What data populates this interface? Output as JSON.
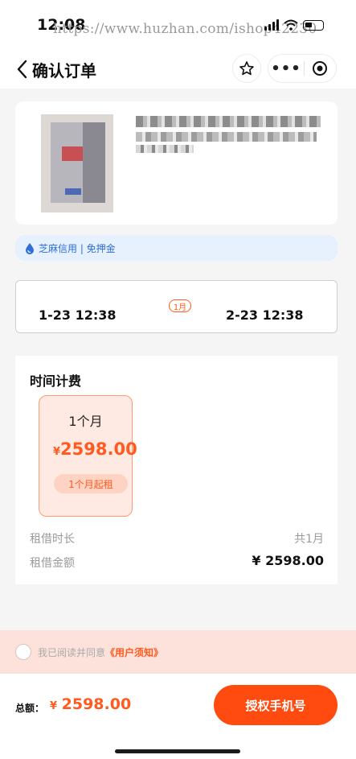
{
  "status": {
    "time": "12:08",
    "watermark": "https://www.huzhan.com/ishop42230"
  },
  "navbar": {
    "title": "确认订单",
    "more_label": "•••"
  },
  "credit": {
    "text": "芝麻信用 | 免押金"
  },
  "rental_dates": {
    "start": "1-23 12:38",
    "duration": "1月",
    "end": "2-23 12:38"
  },
  "fee": {
    "title": "时间计费",
    "plan": {
      "name": "1个月",
      "currency": "¥",
      "price": "2598.00",
      "tag": "1个月起租"
    },
    "rows": [
      {
        "label": "租借时长",
        "value": "共1月"
      },
      {
        "label": "租借金额",
        "value": "¥ 2598.00"
      }
    ]
  },
  "agreement": {
    "text": "我已阅读并同意",
    "link": "《用户须知》"
  },
  "footer": {
    "total_label": "总额：",
    "currency": "¥",
    "total": "2598.00",
    "button": "授权手机号"
  },
  "colors": {
    "accent": "#ff4a10",
    "credit_blue": "#2f6fd6"
  }
}
